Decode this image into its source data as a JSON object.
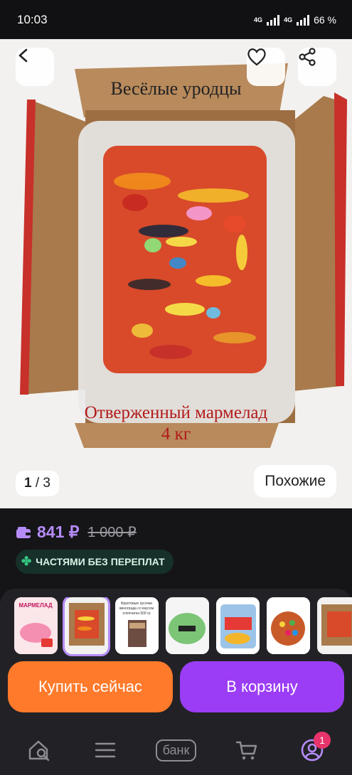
{
  "status": {
    "time": "10:03",
    "network1": "4G",
    "network2": "4G",
    "battery": "66 %"
  },
  "hero": {
    "title": "Весёлые уродцы",
    "caption_line1": "Отверженный мармелад",
    "caption_line2": "4 кг",
    "counter_current": "1",
    "counter_total": "/ 3",
    "similar_label": "Похожие"
  },
  "price": {
    "current": "841 ₽",
    "old": "1 000 ₽",
    "installment": "ЧАСТЯМИ БЕЗ ПЕРЕПЛАТ"
  },
  "thumbnails": [
    {
      "name": "marmalade-pack",
      "label": "МАРМЕЛАД"
    },
    {
      "name": "box-gummies",
      "label": ""
    },
    {
      "name": "fruit-pieces",
      "label": "Фруктовые кусочки винограда со вкусом хлопчатка 500 гр"
    },
    {
      "name": "green-candy",
      "label": ""
    },
    {
      "name": "candy-bag",
      "label": ""
    },
    {
      "name": "colorful-candies",
      "label": ""
    },
    {
      "name": "box-gummies-2",
      "label": ""
    }
  ],
  "actions": {
    "buy_now": "Купить сейчас",
    "add_to_cart": "В корзину"
  },
  "tabbar": {
    "bank_label": "банк",
    "profile_badge": "1"
  },
  "colors": {
    "accent": "#9b3df5",
    "buy": "#ff7a2b",
    "price": "#b58cf7"
  }
}
